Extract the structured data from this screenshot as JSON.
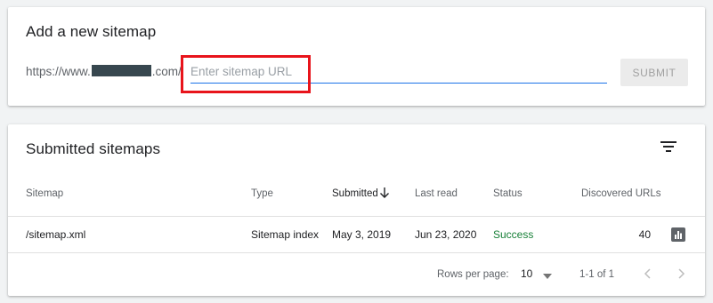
{
  "add_card": {
    "title": "Add a new sitemap",
    "url_prefix_start": "https://www.",
    "url_prefix_end": ".com/",
    "input_value": "",
    "input_placeholder": "Enter sitemap URL",
    "submit_label": "SUBMIT"
  },
  "list_card": {
    "title": "Submitted sitemaps",
    "filter_icon": "filter-list-icon",
    "columns": {
      "sitemap": "Sitemap",
      "type": "Type",
      "submitted": "Submitted",
      "last_read": "Last read",
      "status": "Status",
      "discovered": "Discovered URLs"
    },
    "rows": [
      {
        "sitemap": "/sitemap.xml",
        "type": "Sitemap index",
        "submitted": "May 3, 2019",
        "last_read": "Jun 23, 2020",
        "status": "Success",
        "discovered": "40"
      }
    ],
    "footer": {
      "rows_per_page_label": "Rows per page:",
      "rows_per_page_value": "10",
      "range": "1-1 of 1"
    }
  },
  "colors": {
    "accent_blue": "#1a73e8",
    "success_green": "#188038",
    "highlight_red": "#e8141b"
  }
}
